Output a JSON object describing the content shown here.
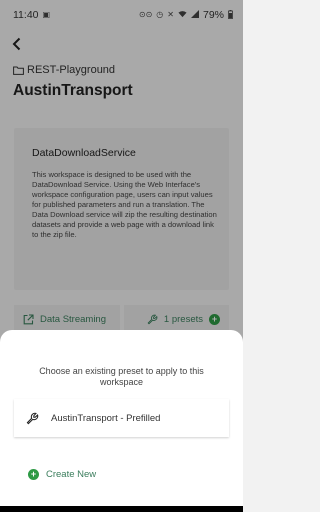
{
  "status_bar": {
    "time": "11:40",
    "battery": "79%"
  },
  "header": {
    "breadcrumb": "REST-Playground",
    "title": "AustinTransport"
  },
  "card": {
    "title": "DataDownloadService",
    "description": "This workspace is designed to be used with the DataDownload Service. Using the Web Interface's workspace configuration page, users can input values for published parameters and run a translation. The Data Download service will zip the resulting destination datasets and provide a web page with a download link to the zip file."
  },
  "actions": {
    "data_streaming": "Data Streaming",
    "presets": "1 presets"
  },
  "sheet": {
    "prompt": "Choose an existing preset to apply to this workspace",
    "preset_name": "AustinTransport - Prefilled",
    "create_new": "Create New"
  },
  "colors": {
    "accent_green": "#2e9a45",
    "link_green": "#3a7d5c"
  },
  "icons": {
    "status_left": [
      "image-icon"
    ],
    "status_right": [
      "voicemail-icon",
      "alarm-icon",
      "mute-icon",
      "wifi-icon",
      "signal-icon",
      "battery-icon"
    ],
    "back": "back-arrow-icon",
    "breadcrumb": "folder-icon",
    "data_streaming": "external-link-icon",
    "presets": "wrench-icon",
    "preset_item": "wrench-icon",
    "create_new": "plus-circle-icon"
  }
}
